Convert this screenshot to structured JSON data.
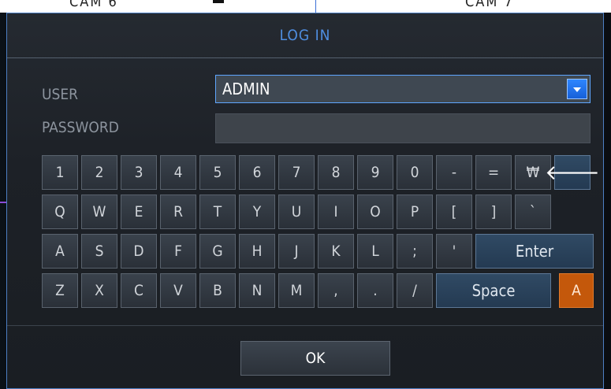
{
  "background": {
    "cam_left": "CAM 6",
    "cam_right": "CAM 7"
  },
  "dialog": {
    "title": "LOG IN",
    "user_label": "USER",
    "user_value": "ADMIN",
    "password_label": "PASSWORD",
    "password_value": "",
    "ok_label": "OK"
  },
  "keyboard": {
    "rows": [
      [
        "1",
        "2",
        "3",
        "4",
        "5",
        "6",
        "7",
        "8",
        "9",
        "0",
        "-",
        "=",
        "₩",
        "🡐"
      ],
      [
        "Q",
        "W",
        "E",
        "R",
        "T",
        "Y",
        "U",
        "I",
        "O",
        "P",
        "[",
        "]",
        "`"
      ],
      [
        "A",
        "S",
        "D",
        "F",
        "G",
        "H",
        "J",
        "K",
        "L",
        ";",
        "'"
      ],
      [
        "Z",
        "X",
        "C",
        "V",
        "B",
        "N",
        "M",
        ",",
        ".",
        "/"
      ]
    ],
    "enter_label": "Enter",
    "space_label": "Space",
    "case_label": "A"
  },
  "colors": {
    "accent": "#4f8ee0",
    "dropdown": "#1f6fe8",
    "case_toggle": "#c4580b"
  }
}
